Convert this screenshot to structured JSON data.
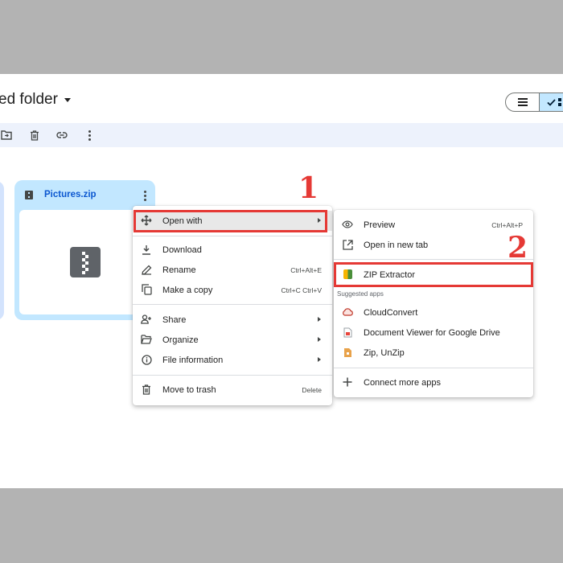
{
  "header": {
    "folder_title": "ed folder"
  },
  "card": {
    "file_name": "Pictures.zip"
  },
  "context_menu": {
    "items": [
      {
        "label": "Open with",
        "shortcut": ""
      },
      {
        "label": "Download",
        "shortcut": ""
      },
      {
        "label": "Rename",
        "shortcut": "Ctrl+Alt+E"
      },
      {
        "label": "Make a copy",
        "shortcut": "Ctrl+C Ctrl+V"
      },
      {
        "label": "Share",
        "shortcut": ""
      },
      {
        "label": "Organize",
        "shortcut": ""
      },
      {
        "label": "File information",
        "shortcut": ""
      },
      {
        "label": "Move to trash",
        "shortcut": "Delete"
      }
    ]
  },
  "submenu": {
    "items": [
      {
        "label": "Preview",
        "shortcut": "Ctrl+Alt+P"
      },
      {
        "label": "Open in new tab",
        "shortcut": ""
      },
      {
        "label": "ZIP Extractor",
        "shortcut": ""
      },
      {
        "label": "CloudConvert",
        "shortcut": ""
      },
      {
        "label": "Document Viewer for Google Drive",
        "shortcut": ""
      },
      {
        "label": "Zip, UnZip",
        "shortcut": ""
      },
      {
        "label": "Connect more apps",
        "shortcut": ""
      }
    ],
    "suggested_label": "Suggested apps"
  },
  "annotations": {
    "step1": "1",
    "step2": "2"
  },
  "colors": {
    "highlight_red": "#e53935",
    "selected_card": "#c2e7ff",
    "toolbar_bg": "#edf2fc",
    "link_blue": "#0b57d0"
  }
}
